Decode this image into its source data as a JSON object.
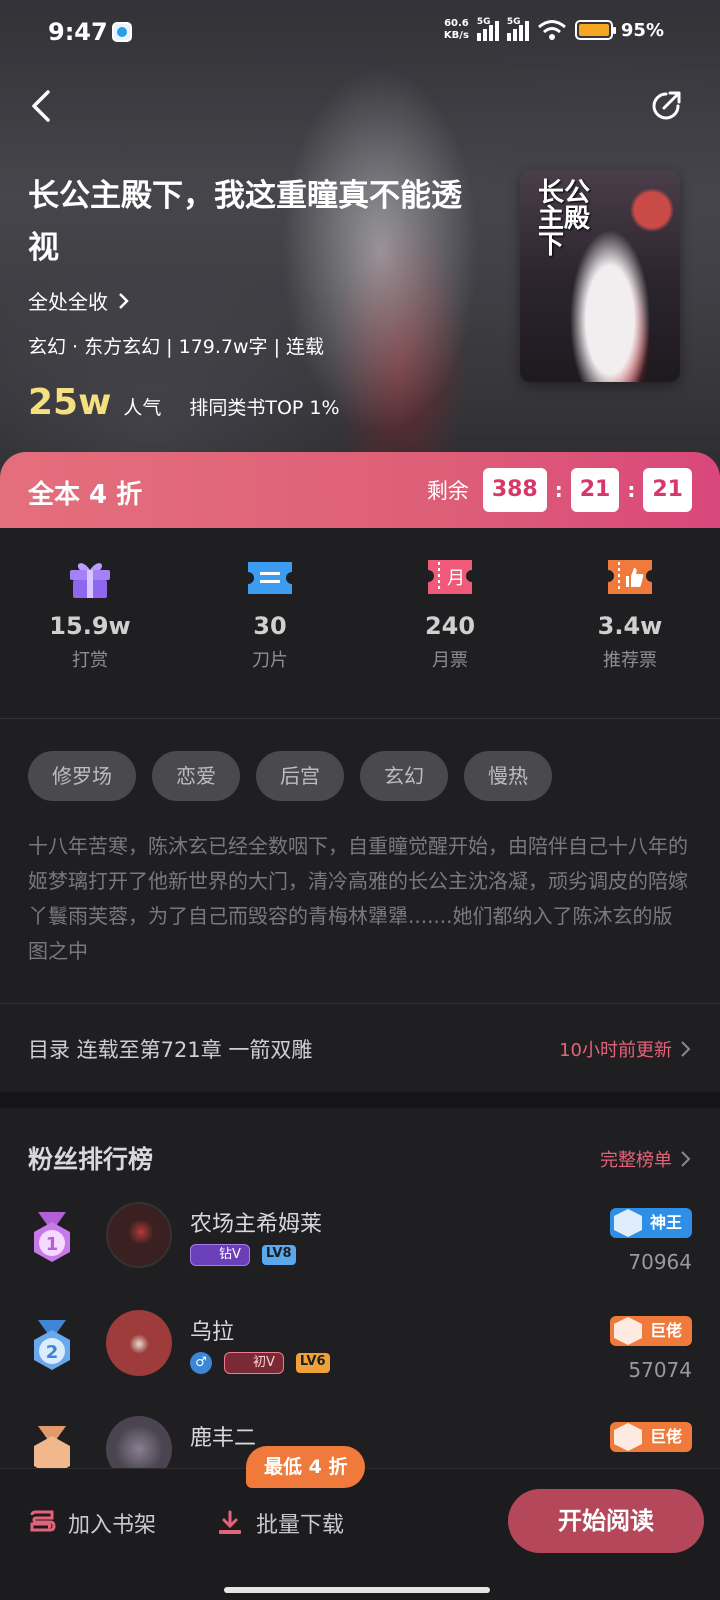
{
  "status_bar": {
    "time": "9:47",
    "speed_value": "60.6",
    "speed_unit": "KB/s",
    "battery": "95%"
  },
  "book": {
    "title": "长公主殿下，我这重瞳真不能透视",
    "author": "全处全收",
    "genre": "玄幻 · 东方玄幻 | 179.7w字 | 连载",
    "popularity_value": "25w",
    "popularity_label": "人气",
    "rank": "排同类书TOP 1%",
    "cover_title": "长公主殿下"
  },
  "promo": {
    "label": "全本 4 折",
    "remain_label": "剩余",
    "hours": "388",
    "minutes": "21",
    "seconds": "21"
  },
  "stats": [
    {
      "value": "15.9w",
      "label": "打赏",
      "icon": "gift-icon"
    },
    {
      "value": "30",
      "label": "刀片",
      "icon": "ticket-icon"
    },
    {
      "value": "240",
      "label": "月票",
      "icon": "monthly-ticket-icon"
    },
    {
      "value": "3.4w",
      "label": "推荐票",
      "icon": "thumbs-up-ticket-icon"
    }
  ],
  "tags": [
    "修罗场",
    "恋爱",
    "后宫",
    "玄幻",
    "慢热"
  ],
  "description": "十八年苦寒，陈沐玄已经全数咽下，自重瞳觉醒开始，由陪伴自己十八年的姬梦璃打开了他新世界的大门，清冷高雅的长公主沈洛凝，顽劣调皮的陪嫁丫鬟雨芙蓉，为了自己而毁容的青梅林犟犟.......她们都纳入了陈沐玄的版图之中",
  "catalog": {
    "text": "目录 连载至第721章 一箭双雕",
    "update": "10小时前更新"
  },
  "fans": {
    "title": "粉丝排行榜",
    "full_list": "完整榜单",
    "rows": [
      {
        "rank": "1",
        "name": "农场主希姆莱",
        "vip": "钻V",
        "level": "LV8",
        "title": "神王",
        "score": "70964",
        "title_color": "#2f8fe6"
      },
      {
        "rank": "2",
        "name": "乌拉",
        "vip": "初V",
        "level": "LV6",
        "title": "巨佬",
        "score": "57074",
        "title_color": "#f07a3b"
      },
      {
        "rank": "3",
        "name": "鹿丰二",
        "vip": "",
        "level": "",
        "title": "巨佬",
        "score": "",
        "title_color": "#f07a3b"
      }
    ]
  },
  "bottom": {
    "shelf": "加入书架",
    "download": "批量下载",
    "discount": "最低 4 折",
    "read": "开始阅读"
  }
}
